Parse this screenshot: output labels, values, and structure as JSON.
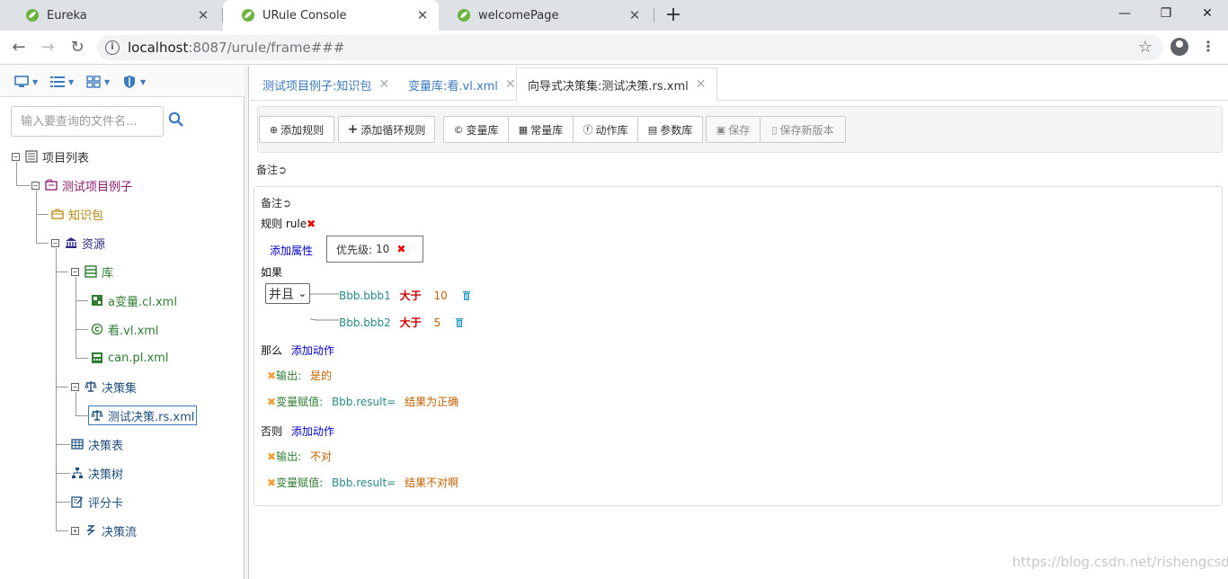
{
  "browser": {
    "tabs": [
      {
        "title": "Eureka"
      },
      {
        "title": "URule Console"
      },
      {
        "title": "welcomePage"
      }
    ],
    "new_tab": "+",
    "window": {
      "minimize": "—",
      "maximize": "❐",
      "close": "✕"
    },
    "url_host": "localhost",
    "url_rest": ":8087/urule/frame###"
  },
  "sidebar": {
    "search_placeholder": "输入要查询的文件名...",
    "tree": {
      "root": "项目列表",
      "project": "测试项目例子",
      "package": "知识包",
      "resources": "资源",
      "library": "库",
      "lib_items": [
        "a变量.cl.xml",
        "看.vl.xml",
        "can.pl.xml"
      ],
      "ruleset": "决策集",
      "ruleset_item": "测试决策.rs.xml",
      "table": "决策表",
      "dtree": "决策树",
      "scorecard": "评分卡",
      "flow": "决策流"
    }
  },
  "file_tabs": [
    {
      "label": "测试项目例子:知识包"
    },
    {
      "label": "变量库:看.vl.xml"
    },
    {
      "label": "向导式决策集:测试决策.rs.xml"
    }
  ],
  "toolbar": {
    "add_rule": "添加规则",
    "add_loop_rule": "添加循环规则",
    "var_lib": "变量库",
    "const_lib": "常量库",
    "action_lib": "动作库",
    "param_lib": "参数库",
    "save": "保存",
    "save_new_version": "保存新版本"
  },
  "editor": {
    "remark": "备注",
    "rule_label": "规则 rule",
    "add_property": "添加属性",
    "priority_label": "优先级:",
    "priority_value": "10",
    "if_label": "如果",
    "join_op": "并且",
    "conditions": [
      {
        "left": "Bbb.bbb1",
        "op": "大于",
        "value": "10"
      },
      {
        "left": "Bbb.bbb2",
        "op": "大于",
        "value": "5"
      }
    ],
    "then_label": "那么",
    "else_label": "否则",
    "add_action": "添加动作",
    "then_actions": [
      {
        "type": "输出:",
        "var": "",
        "value": "是的"
      },
      {
        "type": "变量赋值:",
        "var": "Bbb.result=",
        "value": "结果为正确"
      }
    ],
    "else_actions": [
      {
        "type": "输出:",
        "var": "",
        "value": "不对"
      },
      {
        "type": "变量赋值:",
        "var": "Bbb.result=",
        "value": "结果不对啊"
      }
    ]
  },
  "watermark": "https://blog.csdn.net/rishengcsdn",
  "colors": {
    "link_blue": "#3b7bbd",
    "tree_green": "#2e7d32",
    "project_purple": "#8b1a6b",
    "package_gold": "#b8860b",
    "teal": "#2a8a8a",
    "op_red": "#cc0000",
    "value_orange": "#c06000"
  }
}
